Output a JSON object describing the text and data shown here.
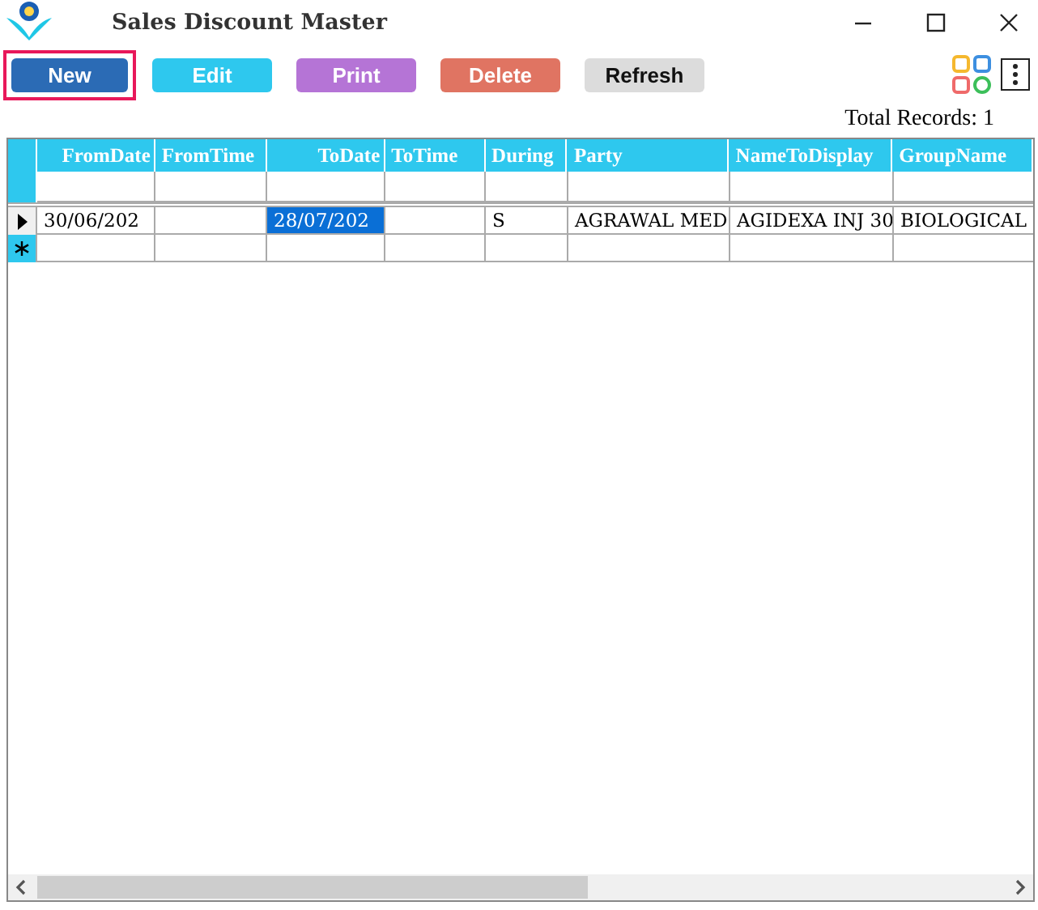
{
  "window": {
    "title": "Sales Discount Master"
  },
  "toolbar": [
    {
      "label": "New",
      "kind": "new",
      "focused": true
    },
    {
      "label": "Edit",
      "kind": "edit",
      "focused": false
    },
    {
      "label": "Print",
      "kind": "print",
      "focused": false
    },
    {
      "label": "Delete",
      "kind": "delete",
      "focused": false
    },
    {
      "label": "Refresh",
      "kind": "refresh",
      "focused": false
    }
  ],
  "total_records": "Total Records: 1",
  "table": {
    "columns": [
      "FromDate",
      "FromTime",
      "ToDate",
      "ToTime",
      "During",
      "Party",
      "NameToDisplay",
      "GroupName"
    ],
    "rows": [
      {
        "kind": "data",
        "current": true,
        "cells": [
          {
            "text": "30/06/202",
            "selected": false
          },
          {
            "text": "",
            "selected": false
          },
          {
            "text": "28/07/202",
            "selected": true
          },
          {
            "text": "",
            "selected": false
          },
          {
            "text": "S",
            "selected": false
          },
          {
            "text": "AGRAWAL MED",
            "selected": false
          },
          {
            "text": "AGIDEXA INJ 30",
            "selected": false
          },
          {
            "text": "BIOLOGICAL",
            "selected": false
          }
        ]
      },
      {
        "kind": "new",
        "current": false,
        "cells": []
      }
    ]
  }
}
